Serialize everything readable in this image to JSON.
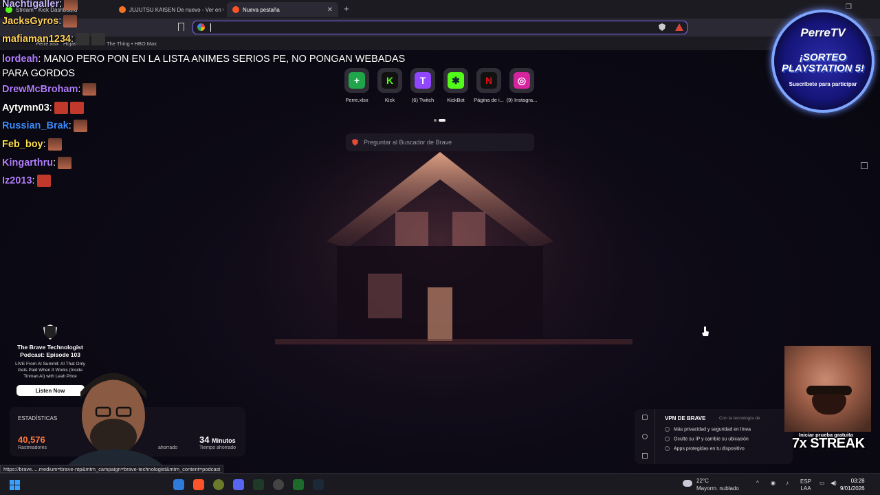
{
  "browser": {
    "tabs": [
      {
        "label": "Stream - Kick Dashboard",
        "color": "#53fc18"
      },
      {
        "label": "JUJUTSU KAISEN De nuevo - Ver en C",
        "color": "#f47521"
      },
      {
        "label": "Nueva pestaña",
        "color": "#fb542b",
        "active": true
      }
    ],
    "new_tab": "+",
    "bookmarks": [
      "Perre.xlsx",
      "Hojas c",
      "The Thing • HBO Max"
    ],
    "omnibox_value": ""
  },
  "chat": [
    {
      "user": "Nachtigaller",
      "color": "#c9b8ff",
      "text": ":"
    },
    {
      "user": "JacksGyros",
      "color": "#ffd25a",
      "text": ":"
    },
    {
      "user": "mafiaman1234",
      "color": "#ffd25a",
      "text": ":"
    },
    {
      "user": "lordeah",
      "color": "#b27dff",
      "text": ": MANO PERO PON EN LA LISTA ANIMES SERIOS PE, NO PONGAN WEBADAS PARA GORDOS"
    },
    {
      "user": "DrewMcBroham",
      "color": "#b27dff",
      "text": ":"
    },
    {
      "user": "Aytymn03",
      "color": "#ffffff",
      "text": ":"
    },
    {
      "user": "Russian_Brak",
      "color": "#3d8bff",
      "text": ":"
    },
    {
      "user": "Feb_boy",
      "color": "#ffe04a",
      "text": ":"
    },
    {
      "user": "Kingarthru",
      "color": "#b27dff",
      "text": ":"
    },
    {
      "user": "Iz2013",
      "color": "#b27dff",
      "text": ":"
    }
  ],
  "top_sites": [
    {
      "label": "Perre.xlsx",
      "glyph": "+",
      "color": "#1fa64a",
      "icon": "plus-icon"
    },
    {
      "label": "Kick",
      "glyph": "K",
      "color": "#53fc18",
      "icon": "kick-icon"
    },
    {
      "label": "(6) Twitch",
      "glyph": "T",
      "color": "#9146ff",
      "icon": "twitch-icon"
    },
    {
      "label": "KickBot",
      "glyph": "✱",
      "color": "#53fc18",
      "icon": "kickbot-icon"
    },
    {
      "label": "Página de i...",
      "glyph": "N",
      "color": "#e50914",
      "icon": "netflix-icon"
    },
    {
      "label": "(9) Instagra...",
      "glyph": "◎",
      "color": "#d6249f",
      "icon": "instagram-icon"
    }
  ],
  "search": {
    "placeholder": "Preguntar al Buscador de Brave"
  },
  "promo": {
    "title": "The Brave Technologist Podcast: Episode 103",
    "description": "LIVE From AI Summit: AI That Only Gets Paid When It Works (Inside Tinman AI) with Leah Price",
    "button": "Listen Now"
  },
  "stats": {
    "title": "ESTADÍSTICAS",
    "trackers_value": "40,576",
    "trackers_label": "Rastreadores",
    "saved_label": "ahorrado",
    "time_value": "34",
    "time_unit": "Minutos",
    "time_label": "Tiempo ahorrado"
  },
  "vpn": {
    "title": "VPN DE BRAVE",
    "subtitle": "Con la tecnología de",
    "features": [
      "Más privacidad y seguridad en línea",
      "Oculte su IP y cambie su ubicación",
      "Apps protegidas en tu dispositivo"
    ],
    "trial": "Iniciar prueba gratuita"
  },
  "overlay": {
    "badge_brand": "PerreTV",
    "badge_line1": "¡SORTEO",
    "badge_line2": "PLAYSTATION 5!",
    "badge_small": "Suscríbete para participar",
    "streak": "7x STREAK"
  },
  "status_url": "https://brave.....medium=brave-ntp&mtm_campaign=brave-technologist&mtm_content=podcast",
  "taskbar": {
    "temperature": "22°C",
    "weather": "Mayorm. nublado",
    "lang_top": "ESP",
    "lang_bottom": "LAA",
    "time": "03:28",
    "date": "9/01/2026"
  }
}
